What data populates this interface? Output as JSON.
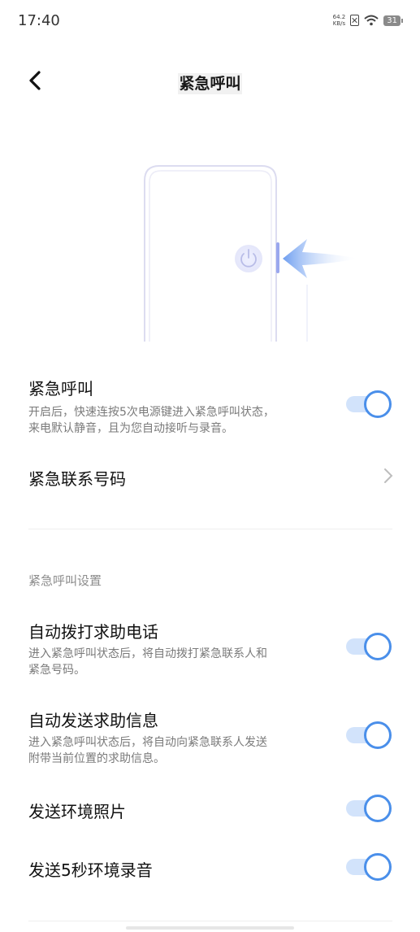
{
  "status": {
    "time": "17:40",
    "net_speed_value": "64.2",
    "net_speed_unit": "KB/s",
    "battery": "31",
    "icons": [
      "sim-off-icon",
      "wifi-icon",
      "battery-icon"
    ]
  },
  "header": {
    "title": "紧急呼叫",
    "back_icon": "back-arrow-icon"
  },
  "illustration": {
    "icons": [
      "phone-outline",
      "power-icon",
      "arrow-left-icon"
    ]
  },
  "emergency_call": {
    "title": "紧急呼叫",
    "desc_line1": "开启后，快速连按5次电源键进入紧急呼叫状态，",
    "desc_line2": "来电默认静音，且为您自动接听与录音。",
    "enabled": true
  },
  "contacts": {
    "title": "紧急联系号码",
    "icon": "chevron-right-icon"
  },
  "section": {
    "label": "紧急呼叫设置"
  },
  "settings": {
    "auto_dial": {
      "title": "自动拨打求助电话",
      "desc_line1": "进入紧急呼叫状态后，将自动拨打紧急联系人和",
      "desc_line2": "紧急号码。",
      "enabled": true
    },
    "auto_message": {
      "title": "自动发送求助信息",
      "desc_line1": "进入紧急呼叫状态后，将自动向紧急联系人发送",
      "desc_line2": "附带当前位置的求助信息。",
      "enabled": true
    },
    "send_photo": {
      "title": "发送环境照片",
      "enabled": true
    },
    "send_audio": {
      "title": "发送5秒环境录音",
      "enabled": true
    }
  },
  "colors": {
    "accent": "#4a8fea",
    "track": "#d2e3fb",
    "desc": "#7a7a7a"
  }
}
